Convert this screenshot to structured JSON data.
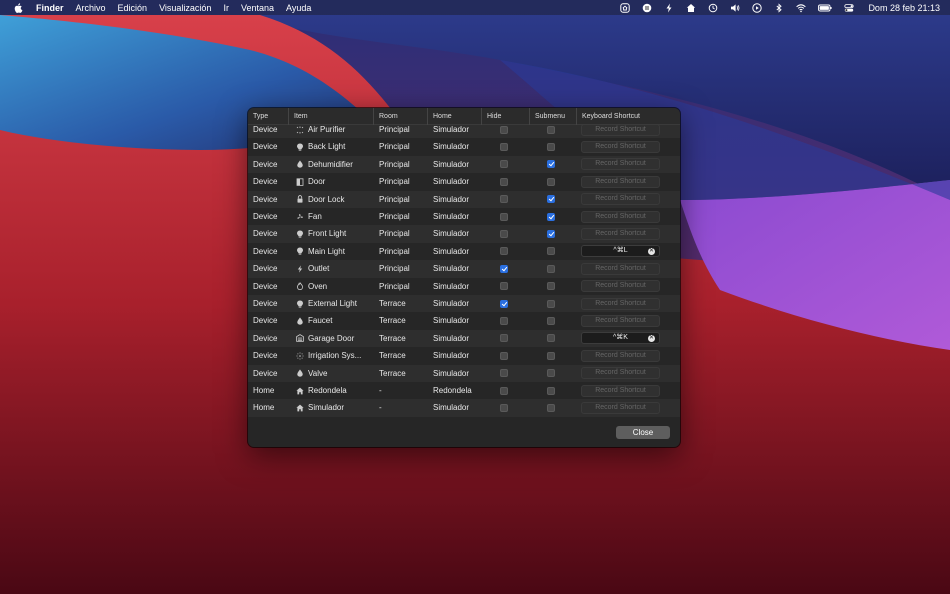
{
  "menubar": {
    "items": [
      "Finder",
      "Archivo",
      "Edición",
      "Visualización",
      "Ir",
      "Ventana",
      "Ayuda"
    ],
    "clock": "Dom 28 feb  21:13",
    "status_icons": [
      "home-status-icon",
      "vpn-icon",
      "bolt-icon",
      "house-icon",
      "time-machine-icon",
      "volume-icon",
      "play-icon",
      "bluetooth-icon",
      "wifi-icon",
      "battery-icon",
      "control-center-icon"
    ]
  },
  "table": {
    "headers": [
      "Type",
      "Item",
      "Room",
      "Home",
      "Hide",
      "Submenu",
      "Keyboard Shortcut"
    ],
    "shortcut_placeholder": "Record Shortcut",
    "rows": [
      {
        "type": "Device",
        "icon": "air-purifier-icon",
        "item": "Air Purifier",
        "room": "Principal",
        "home": "Simulador",
        "hide": false,
        "submenu": false,
        "shortcut": ""
      },
      {
        "type": "Device",
        "icon": "bulb-icon",
        "item": "Back Light",
        "room": "Principal",
        "home": "Simulador",
        "hide": false,
        "submenu": false,
        "shortcut": ""
      },
      {
        "type": "Device",
        "icon": "drop-icon",
        "item": "Dehumidifier",
        "room": "Principal",
        "home": "Simulador",
        "hide": false,
        "submenu": true,
        "shortcut": ""
      },
      {
        "type": "Device",
        "icon": "door-icon",
        "item": "Door",
        "room": "Principal",
        "home": "Simulador",
        "hide": false,
        "submenu": false,
        "shortcut": ""
      },
      {
        "type": "Device",
        "icon": "lock-icon",
        "item": "Door Lock",
        "room": "Principal",
        "home": "Simulador",
        "hide": false,
        "submenu": true,
        "shortcut": ""
      },
      {
        "type": "Device",
        "icon": "fan-icon",
        "item": "Fan",
        "room": "Principal",
        "home": "Simulador",
        "hide": false,
        "submenu": true,
        "shortcut": ""
      },
      {
        "type": "Device",
        "icon": "bulb-icon",
        "item": "Front Light",
        "room": "Principal",
        "home": "Simulador",
        "hide": false,
        "submenu": true,
        "shortcut": ""
      },
      {
        "type": "Device",
        "icon": "bulb-icon",
        "item": "Main Light",
        "room": "Principal",
        "home": "Simulador",
        "hide": false,
        "submenu": false,
        "shortcut": "^⌘L"
      },
      {
        "type": "Device",
        "icon": "bolt-icon",
        "item": "Outlet",
        "room": "Principal",
        "home": "Simulador",
        "hide": true,
        "submenu": false,
        "shortcut": ""
      },
      {
        "type": "Device",
        "icon": "flame-icon",
        "item": "Oven",
        "room": "Principal",
        "home": "Simulador",
        "hide": false,
        "submenu": false,
        "shortcut": ""
      },
      {
        "type": "Device",
        "icon": "bulb-icon",
        "item": "External Light",
        "room": "Terrace",
        "home": "Simulador",
        "hide": true,
        "submenu": false,
        "shortcut": ""
      },
      {
        "type": "Device",
        "icon": "drop-icon",
        "item": "Faucet",
        "room": "Terrace",
        "home": "Simulador",
        "hide": false,
        "submenu": false,
        "shortcut": ""
      },
      {
        "type": "Device",
        "icon": "garage-icon",
        "item": "Garage Door",
        "room": "Terrace",
        "home": "Simulador",
        "hide": false,
        "submenu": false,
        "shortcut": "^⌘K"
      },
      {
        "type": "Device",
        "icon": "sprinkler-icon",
        "item": "Irrigation Sys...",
        "room": "Terrace",
        "home": "Simulador",
        "hide": false,
        "submenu": false,
        "shortcut": ""
      },
      {
        "type": "Device",
        "icon": "drop-icon",
        "item": "Valve",
        "room": "Terrace",
        "home": "Simulador",
        "hide": false,
        "submenu": false,
        "shortcut": ""
      },
      {
        "type": "Home",
        "icon": "home-icon",
        "item": "Redondela",
        "room": "-",
        "home": "Redondela",
        "hide": false,
        "submenu": false,
        "shortcut": ""
      },
      {
        "type": "Home",
        "icon": "home-icon",
        "item": "Simulador",
        "room": "-",
        "home": "Simulador",
        "hide": false,
        "submenu": false,
        "shortcut": ""
      }
    ]
  },
  "footer": {
    "close_label": "Close"
  },
  "colors": {
    "accent": "#2a6fe0",
    "window_bg": "#262626",
    "row_alt": "#2e2e2e"
  }
}
